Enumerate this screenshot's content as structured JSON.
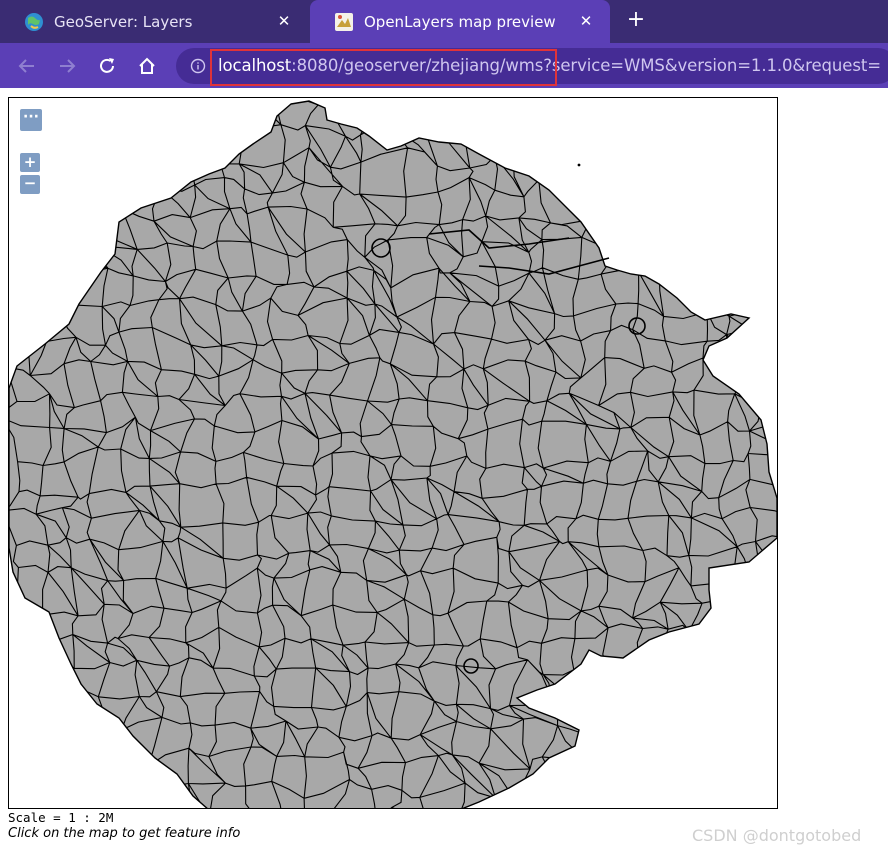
{
  "tabs": [
    {
      "title": "GeoServer: Layers",
      "icon": "geoserver-globe-icon",
      "active": false
    },
    {
      "title": "OpenLayers map preview",
      "icon": "openlayers-icon",
      "active": true
    }
  ],
  "tab_close_glyph": "✕",
  "new_tab_glyph": "+",
  "address_bar": {
    "host": "localhost",
    "rest": ":8080/geoserver/zhejiang/wms?service=WMS&version=1.1.0&request=",
    "highlight_color": "#e0333a"
  },
  "map_controls": {
    "toggle_label": "···",
    "zoom_in_label": "+",
    "zoom_out_label": "−"
  },
  "map": {
    "fill_color": "#a8a8a8",
    "stroke_color": "#000000",
    "background": "#ffffff"
  },
  "footer": {
    "scale": "Scale = 1 : 2M",
    "hint": "Click on the map to get feature info"
  },
  "watermark": "CSDN @dontgotobed",
  "colors": {
    "tabbar": "#3a2c73",
    "toolbar": "#5b3fb6",
    "omnibox": "#452c95"
  }
}
